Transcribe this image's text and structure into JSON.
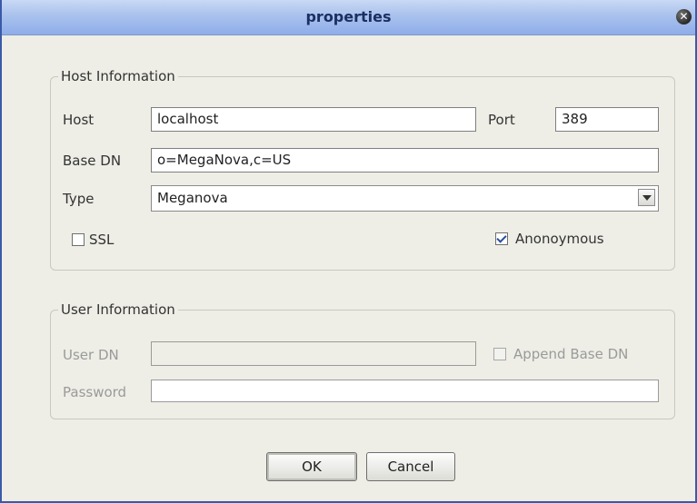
{
  "window": {
    "title": "properties",
    "close_glyph": "✕"
  },
  "host_info": {
    "legend": "Host Information",
    "host_label": "Host",
    "host_value": "localhost",
    "port_label": "Port",
    "port_value": "389",
    "base_dn_label": "Base DN",
    "base_dn_value": "o=MegaNova,c=US",
    "type_label": "Type",
    "type_value": "Meganova",
    "ssl_label": "SSL",
    "ssl_checked": false,
    "anonymous_label": "Anonoymous",
    "anonymous_checked": true
  },
  "user_info": {
    "legend": "User Information",
    "user_dn_label": "User DN",
    "user_dn_value": "",
    "append_base_dn_label": "Append Base DN",
    "append_base_dn_checked": false,
    "password_label": "Password",
    "password_value": ""
  },
  "buttons": {
    "ok": "OK",
    "cancel": "Cancel"
  },
  "icons": {
    "close": "close-icon",
    "dropdown": "chevron-down-icon"
  }
}
